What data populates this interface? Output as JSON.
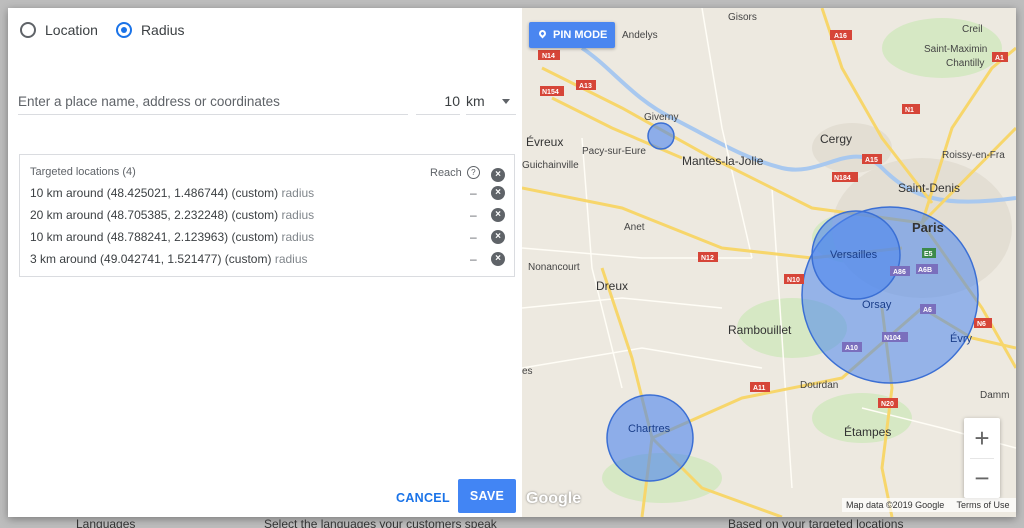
{
  "location_type": {
    "options": [
      {
        "label": "Location",
        "selected": false
      },
      {
        "label": "Radius",
        "selected": true
      }
    ]
  },
  "search": {
    "placeholder": "Enter a place name, address or coordinates",
    "radius_value": "10",
    "unit": "km"
  },
  "targets": {
    "header": "Targeted locations (4)",
    "reach_label": "Reach",
    "rows": [
      {
        "text": "10 km around (48.425021, 1.486744) (custom)",
        "type": "radius",
        "reach": "–"
      },
      {
        "text": "20 km around (48.705385, 2.232248) (custom)",
        "type": "radius",
        "reach": "–"
      },
      {
        "text": "10 km around (48.788241, 2.123963) (custom)",
        "type": "radius",
        "reach": "–"
      },
      {
        "text": "3 km around (49.042741, 1.521477) (custom)",
        "type": "radius",
        "reach": "–"
      }
    ]
  },
  "actions": {
    "cancel": "CANCEL",
    "save": "SAVE"
  },
  "map": {
    "pin_mode": "PIN MODE",
    "attribution": "Map data ©2019 Google",
    "terms": "Terms of Use",
    "logo": "Google",
    "zoom_in": "+",
    "zoom_out": "−",
    "places": {
      "gisors": "Gisors",
      "andelys": "Andelys",
      "creil": "Creil",
      "saint_maximin": "Saint-Maximin",
      "chantilly": "Chantilly",
      "giverny": "Giverny",
      "evreux": "Évreux",
      "pacy": "Pacy-sur-Eure",
      "mantes": "Mantes-la-Jolie",
      "cergy": "Cergy",
      "roissy": "Roissy-en-Fra",
      "guichainville": "Guichainville",
      "saint_denis": "Saint-Denis",
      "paris": "Paris",
      "anet": "Anet",
      "versailles": "Versailles",
      "nonancourt": "Nonancourt",
      "dreux": "Dreux",
      "orsay": "Orsay",
      "rambouillet": "Rambouillet",
      "evry": "Évry",
      "dourdan": "Dourdan",
      "chartres": "Chartres",
      "etampes": "Étampes",
      "damm": "Damm",
      "es": "es"
    },
    "roads": [
      "A16",
      "N14",
      "A13",
      "N154",
      "N1",
      "A15",
      "N184",
      "N12",
      "N10",
      "N104",
      "A10",
      "A11",
      "N20",
      "A86",
      "A6B",
      "E5",
      "N6",
      "A6",
      "A1"
    ]
  },
  "background": {
    "languages": "Languages",
    "languages_hint": "Select the languages your customers speak",
    "based_on": "Based on your targeted locations"
  }
}
